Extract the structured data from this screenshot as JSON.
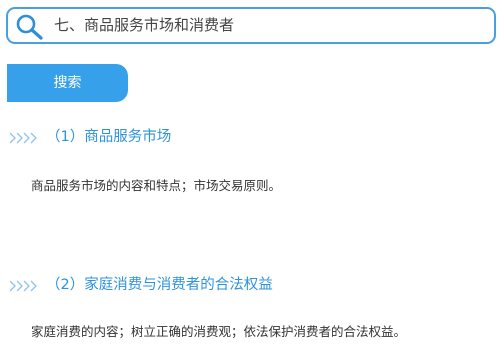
{
  "search": {
    "query": "七、商品服务市场和消费者",
    "button_label": "搜索"
  },
  "sections": [
    {
      "heading": "（1）商品服务市场",
      "body": "商品服务市场的内容和特点；市场交易原则。"
    },
    {
      "heading": "（2）家庭消费与消费者的合法权益",
      "body": "家庭消费的内容；树立正确的消费观；依法保护消费者的合法权益。"
    }
  ],
  "colors": {
    "accent": "#37a0ea",
    "border": "#4a9fe0",
    "heading": "#2e93dc",
    "chevron": "#8fc3ec"
  },
  "icons": {
    "search": "search-icon",
    "section_marker": "chevrons-right-icon"
  }
}
